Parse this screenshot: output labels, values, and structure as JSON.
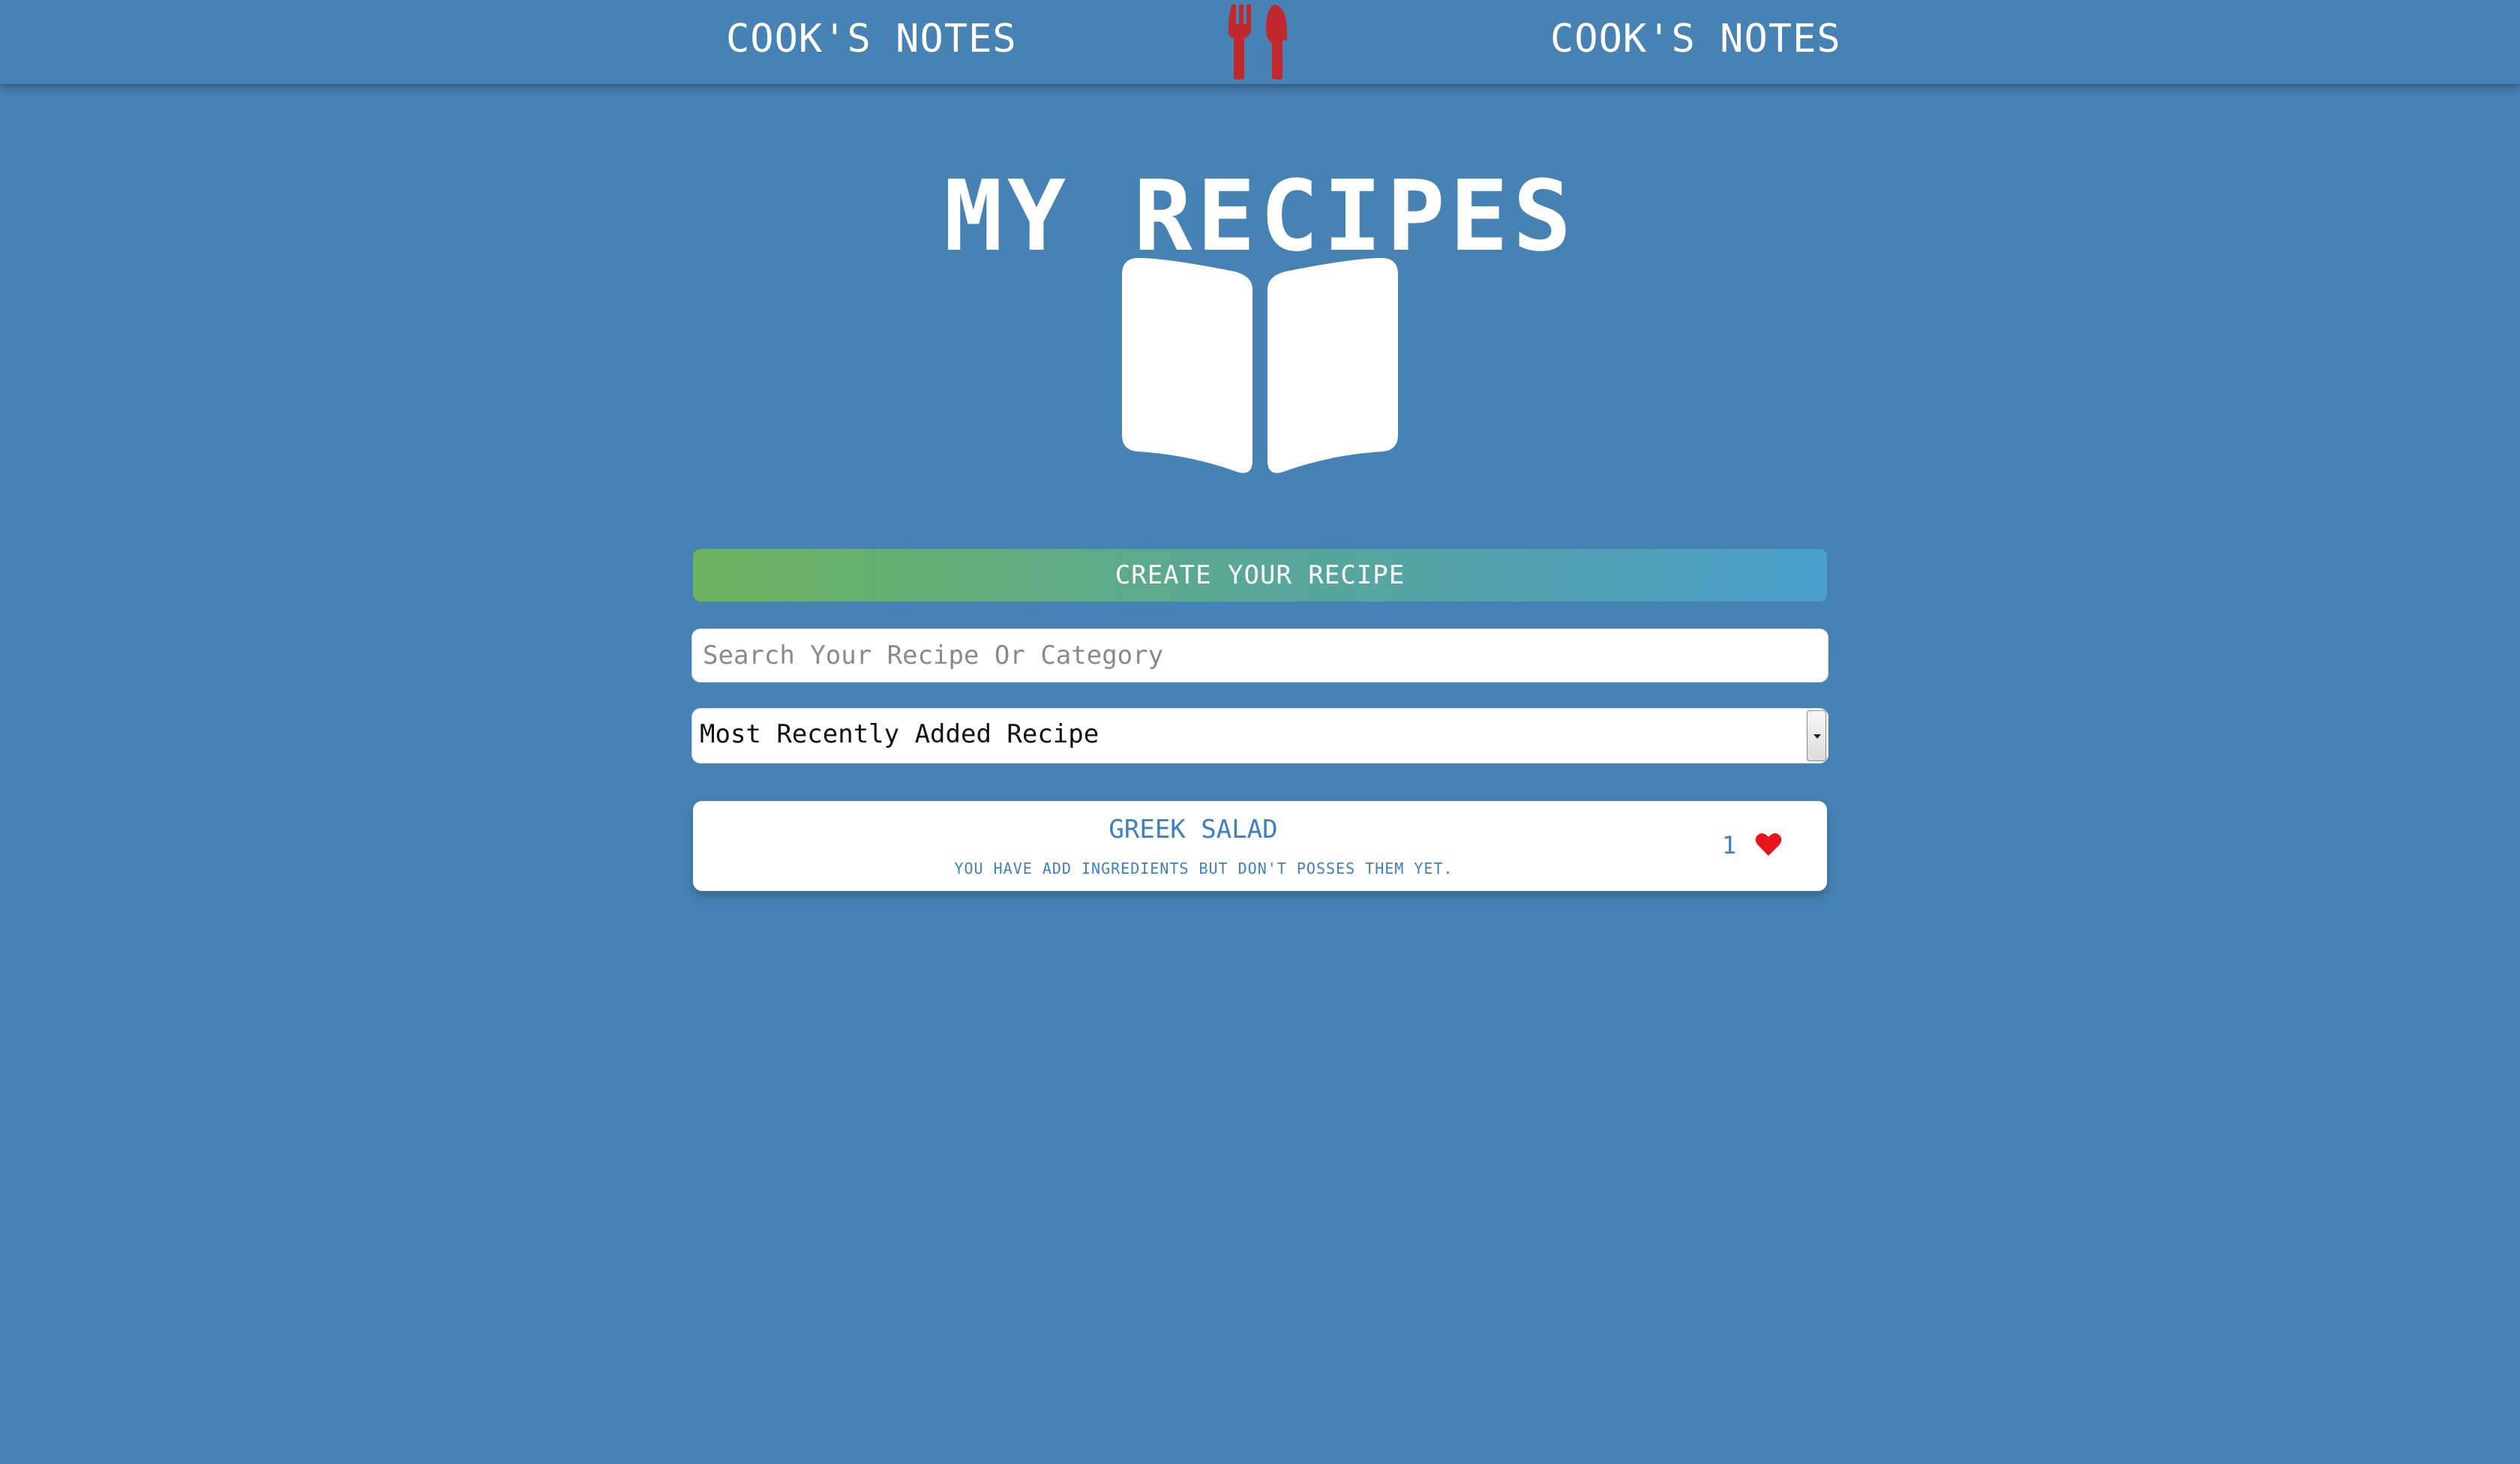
{
  "header": {
    "brand_left": "COOK'S NOTES",
    "brand_right": "COOK'S NOTES",
    "logo_icon": "fork-knife-icon"
  },
  "main": {
    "title": "MY RECIPES",
    "book_icon": "open-book-icon",
    "create_button": "CREATE YOUR RECIPE",
    "search": {
      "placeholder": "Search Your Recipe Or Category",
      "value": ""
    },
    "sort": {
      "selected": "Most Recently Added Recipe"
    }
  },
  "recipes": [
    {
      "name": "GREEK SALAD",
      "note": "YOU HAVE ADD INGREDIENTS BUT DON'T POSSES THEM YET.",
      "likes": "1",
      "like_icon": "heart-icon"
    }
  ],
  "colors": {
    "background": "#4782b4",
    "accent_red": "#c0282d",
    "heart": "#e8141b",
    "card_text": "#3e7fbe",
    "gradient_start": "#6eb35f",
    "gradient_end": "#4a9fcc"
  }
}
